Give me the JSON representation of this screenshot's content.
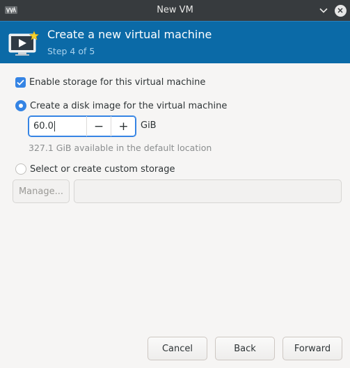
{
  "window": {
    "title": "New VM",
    "app_icon": "virt-manager-icon",
    "controls": [
      "minimize-chevron-icon",
      "close-icon"
    ]
  },
  "header": {
    "title": "Create a new virtual machine",
    "step": "Step 4 of 5",
    "icon": "vm-monitor-play-icon",
    "background_color": "#0b6aa7"
  },
  "storage": {
    "enable_label": "Enable storage for this virtual machine",
    "enable_checked": true,
    "create_disk_label": "Create a disk image for the virtual machine",
    "create_disk_selected": true,
    "disk_size_value": "60.0",
    "decrement_label": "−",
    "increment_label": "+",
    "unit": "GiB",
    "available_text": "327.1 GiB available in the default location",
    "custom_label": "Select or create custom storage",
    "custom_selected": false,
    "manage_label": "Manage...",
    "custom_path_value": ""
  },
  "footer": {
    "cancel_label": "Cancel",
    "back_label": "Back",
    "forward_label": "Forward"
  },
  "colors": {
    "accent": "#3584e4",
    "titlebar": "#373b3e"
  }
}
